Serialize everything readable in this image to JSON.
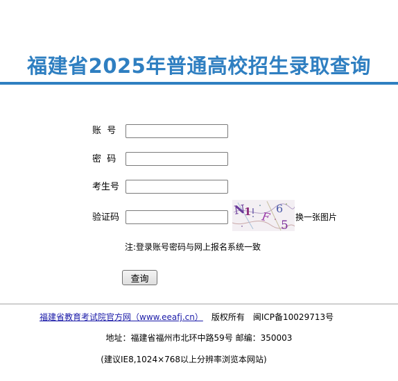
{
  "header": {
    "title": "福建省2025年普通高校招生录取查询"
  },
  "form": {
    "account_label": "账  号",
    "password_label": "密  码",
    "exam_number_label": "考生号",
    "captcha_label": "验证码",
    "account_value": "",
    "password_value": "",
    "exam_number_value": "",
    "captcha_value": "",
    "captcha_text": "N1 F65",
    "swap_image_label": "换一张图片",
    "note": "注:登录账号密码与网上报名系统一致",
    "query_button": "查询"
  },
  "footer": {
    "site_link": "福建省教育考试院官方网（www.eeafj.cn）",
    "copyright": "版权所有",
    "icp": "闽ICP备10029713号",
    "address": "地址：福建省福州市北环中路59号 邮编：350003",
    "browser_note": "(建议IE8,1024×768以上分辨率浏览本网站)"
  },
  "colors": {
    "title_blue": "#2f7fc1",
    "link_blue": "#1a1aa8",
    "captcha_purple": "#7a2a9a"
  }
}
